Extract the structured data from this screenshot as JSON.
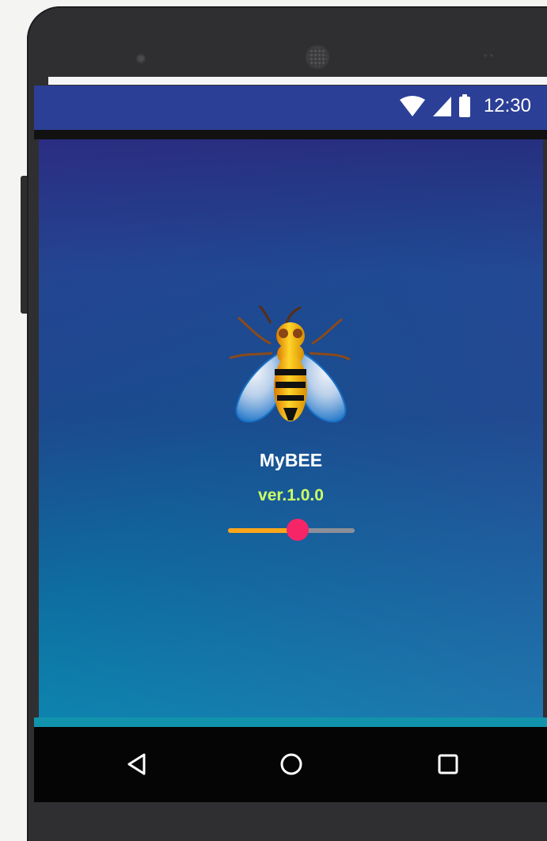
{
  "status_bar": {
    "time": "12:30",
    "icons": [
      "wifi-icon",
      "signal-icon",
      "battery-icon"
    ]
  },
  "app": {
    "name": "MyBEE",
    "version": "ver.1.0.0",
    "logo_icon": "bee-icon",
    "slider": {
      "value_fraction": 0.55
    }
  },
  "navigation": {
    "buttons": [
      {
        "name": "back",
        "icon": "back-triangle-icon"
      },
      {
        "name": "home",
        "icon": "home-circle-icon"
      },
      {
        "name": "recent",
        "icon": "recent-square-icon"
      }
    ]
  },
  "colors": {
    "status_bar": "#2c3f96",
    "gradient_top": "#262f7f",
    "gradient_bottom": "#0a86ae",
    "version_text": "#ccff66",
    "slider_fill": "#f8a51b",
    "slider_thumb": "#f52567",
    "slider_track": "#8b8f98"
  }
}
